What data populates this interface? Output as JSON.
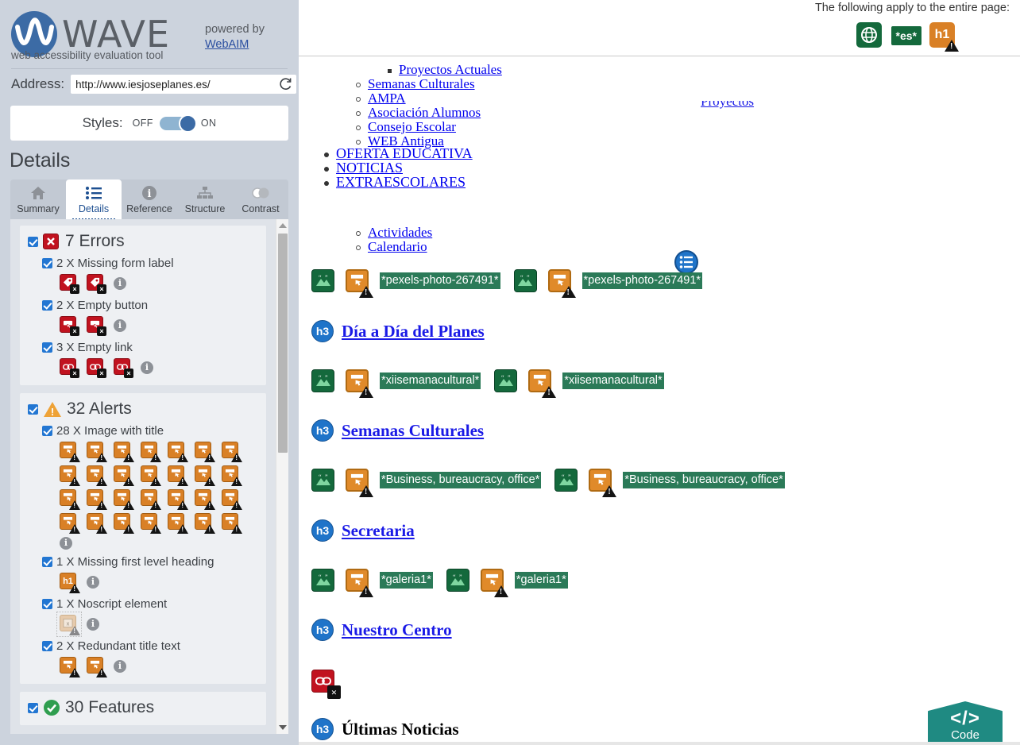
{
  "app": {
    "title": "WAVE",
    "subtitle": "web accessibility evaluation tool",
    "powered_by": "powered by",
    "powered_by_link": "WebAIM",
    "logo_icon": "wave-logo-icon"
  },
  "address": {
    "label": "Address:",
    "value": "http://www.iesjoseplanes.es/",
    "placeholder": "http://www.iesjoseplanes.es/",
    "reload_icon": "reload-icon"
  },
  "styles": {
    "label": "Styles:",
    "off": "OFF",
    "on": "ON",
    "state": "ON"
  },
  "panel": {
    "heading": "Details"
  },
  "tabs": [
    {
      "label": "Summary",
      "icon": "home-icon",
      "active": false
    },
    {
      "label": "Details",
      "icon": "list-icon",
      "active": true
    },
    {
      "label": "Reference",
      "icon": "info-icon",
      "active": false
    },
    {
      "label": "Structure",
      "icon": "sitemap-icon",
      "active": false
    },
    {
      "label": "Contrast",
      "icon": "contrast-icon",
      "active": false
    }
  ],
  "results": {
    "groups": [
      {
        "title": "7 Errors",
        "badge": "error-x-icon",
        "checked": true,
        "items": [
          {
            "title": "2 X Missing form label",
            "checked": true,
            "count": 2,
            "icon": "missing-form-label-icon",
            "info": true
          },
          {
            "title": "2 X Empty button",
            "checked": true,
            "count": 2,
            "icon": "empty-button-icon",
            "info": true
          },
          {
            "title": "3 X Empty link",
            "checked": true,
            "count": 3,
            "icon": "empty-link-icon",
            "info": true
          }
        ]
      },
      {
        "title": "32 Alerts",
        "badge": "alert-triangle-icon",
        "checked": true,
        "items": [
          {
            "title": "28 X Image with title",
            "checked": true,
            "count": 28,
            "icon": "image-with-title-icon",
            "info": true
          },
          {
            "title": "1 X Missing first level heading",
            "checked": true,
            "count": 1,
            "icon": "h1-missing-icon",
            "info": true
          },
          {
            "title": "1 X Noscript element",
            "checked": true,
            "count": 1,
            "icon": "noscript-icon",
            "info": true
          },
          {
            "title": "2 X Redundant title text",
            "checked": true,
            "count": 2,
            "icon": "redundant-title-icon",
            "info": true
          }
        ]
      },
      {
        "title": "30 Features",
        "badge": "feature-check-icon",
        "checked": true,
        "items": []
      }
    ]
  },
  "main": {
    "page_note": "The following apply to the entire page:",
    "page_icons": [
      {
        "icon": "language-globe-icon",
        "label": ""
      },
      {
        "icon": "lang-tag-icon",
        "label": "*es*"
      },
      {
        "icon": "h1-missing-icon",
        "label": "h1"
      }
    ],
    "nav": {
      "sub_items_l3": [
        "Proyectos Actuales"
      ],
      "sub_items_l2": [
        "Semanas Culturales",
        "AMPA",
        "Asociación Alumnos",
        "Consejo Escolar",
        "WEB Antigua"
      ],
      "items_l1": [
        "OFERTA EDUCATIVA",
        "NOTICIAS",
        "EXTRAESCOLARES"
      ],
      "sub_items_l2b": [
        "Actividades",
        "Calendario"
      ],
      "struct_icon": "navigation-list-icon"
    },
    "blocks": [
      {
        "markers": [
          {
            "icon": "alt-text-icon",
            "type": "green"
          },
          {
            "icon": "image-title-icon",
            "type": "orange"
          },
          {
            "text": "*pexels-photo-267491*"
          },
          {
            "icon": "alt-text-icon",
            "type": "green"
          },
          {
            "icon": "image-title-icon",
            "type": "orange"
          },
          {
            "text": "*pexels-photo-267491*"
          }
        ],
        "heading": {
          "badge": "h3",
          "text": "Día a Día del Planes",
          "link": true
        }
      },
      {
        "markers": [
          {
            "icon": "alt-text-icon",
            "type": "green"
          },
          {
            "icon": "image-title-icon",
            "type": "orange"
          },
          {
            "text": "*xiisemanacultural*"
          },
          {
            "icon": "alt-text-icon",
            "type": "green"
          },
          {
            "icon": "image-title-icon",
            "type": "orange"
          },
          {
            "text": "*xiisemanacultural*"
          }
        ],
        "heading": {
          "badge": "h3",
          "text": "Semanas Culturales",
          "link": true
        }
      },
      {
        "markers": [
          {
            "icon": "alt-text-icon",
            "type": "green"
          },
          {
            "icon": "image-title-icon",
            "type": "orange"
          },
          {
            "text": "*Business, bureaucracy, office*"
          },
          {
            "icon": "alt-text-icon",
            "type": "green"
          },
          {
            "icon": "image-title-icon",
            "type": "orange"
          },
          {
            "text": "*Business, bureaucracy, office*"
          }
        ],
        "heading": {
          "badge": "h3",
          "text": "Secretaria",
          "link": true
        }
      },
      {
        "markers": [
          {
            "icon": "alt-text-icon",
            "type": "green"
          },
          {
            "icon": "image-title-icon",
            "type": "orange"
          },
          {
            "text": "*galeria1*"
          },
          {
            "icon": "alt-text-icon",
            "type": "green"
          },
          {
            "icon": "image-title-icon",
            "type": "orange"
          },
          {
            "text": "*galeria1*"
          }
        ],
        "heading": {
          "badge": "h3",
          "text": "Nuestro Centro",
          "link": true
        }
      },
      {
        "markers": [
          {
            "icon": "empty-link-icon",
            "type": "red"
          }
        ],
        "heading": {
          "badge": "h3",
          "text": "Últimas Noticias",
          "link": false
        }
      }
    ],
    "code_button": {
      "label": "Code",
      "glyph": "</>",
      "icon": "code-icon"
    }
  },
  "colors": {
    "brand_blue": "#3c6ba5",
    "error_red": "#c1121f",
    "alert_orange": "#d98026",
    "feature_green": "#14693c",
    "structure_blue": "#1f74c9",
    "code_teal": "#1f8a82",
    "sidebar_bg": "#ccd3dd",
    "link_blue": "#1a1ae6"
  }
}
